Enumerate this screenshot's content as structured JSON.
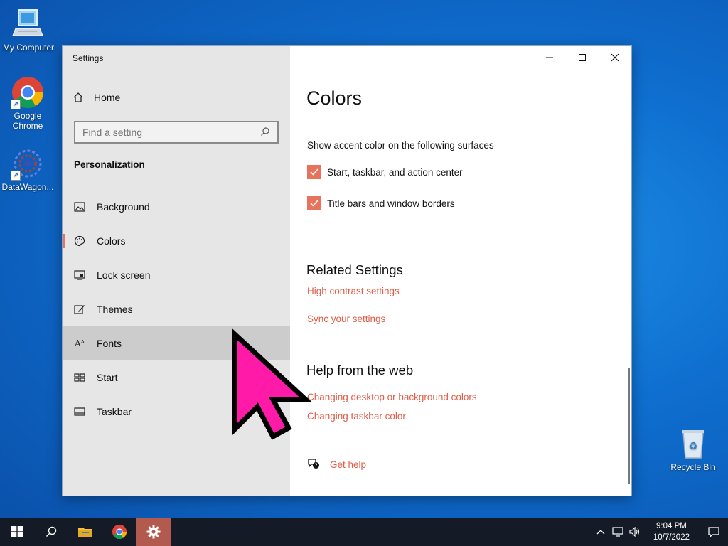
{
  "desktop": {
    "icons": [
      {
        "label": "My Computer",
        "icon": "computer-icon"
      },
      {
        "label": "Google Chrome",
        "icon": "chrome-icon"
      },
      {
        "label": "DataWagon...",
        "icon": "datawagon-icon"
      },
      {
        "label": "Recycle Bin",
        "icon": "recycle-bin-icon"
      }
    ]
  },
  "window": {
    "title": "Settings",
    "controls": [
      "minimize",
      "maximize",
      "close"
    ]
  },
  "sidebar": {
    "home_label": "Home",
    "search_placeholder": "Find a setting",
    "section_heading": "Personalization",
    "items": [
      {
        "label": "Background",
        "icon": "picture-icon"
      },
      {
        "label": "Colors",
        "icon": "palette-icon",
        "selected": true
      },
      {
        "label": "Lock screen",
        "icon": "lock-screen-icon"
      },
      {
        "label": "Themes",
        "icon": "themes-icon"
      },
      {
        "label": "Fonts",
        "icon": "fonts-icon",
        "hovered": true
      },
      {
        "label": "Start",
        "icon": "start-icon"
      },
      {
        "label": "Taskbar",
        "icon": "taskbar-icon"
      }
    ]
  },
  "content": {
    "title": "Colors",
    "accent_prompt": "Show accent color on the following surfaces",
    "checkboxes": [
      {
        "label": "Start, taskbar, and action center",
        "checked": true
      },
      {
        "label": "Title bars and window borders",
        "checked": true
      }
    ],
    "related_heading": "Related Settings",
    "related_links": [
      "High contrast settings",
      "Sync your settings"
    ],
    "help_heading": "Help from the web",
    "help_links": [
      "Changing desktop or background colors",
      "Changing taskbar color"
    ],
    "get_help": "Get help"
  },
  "taskbar": {
    "time": "9:04 PM",
    "date": "10/7/2022"
  },
  "colors": {
    "accent": "#e8735d",
    "link": "#e05e48",
    "pointer": "#ff1aa8"
  }
}
